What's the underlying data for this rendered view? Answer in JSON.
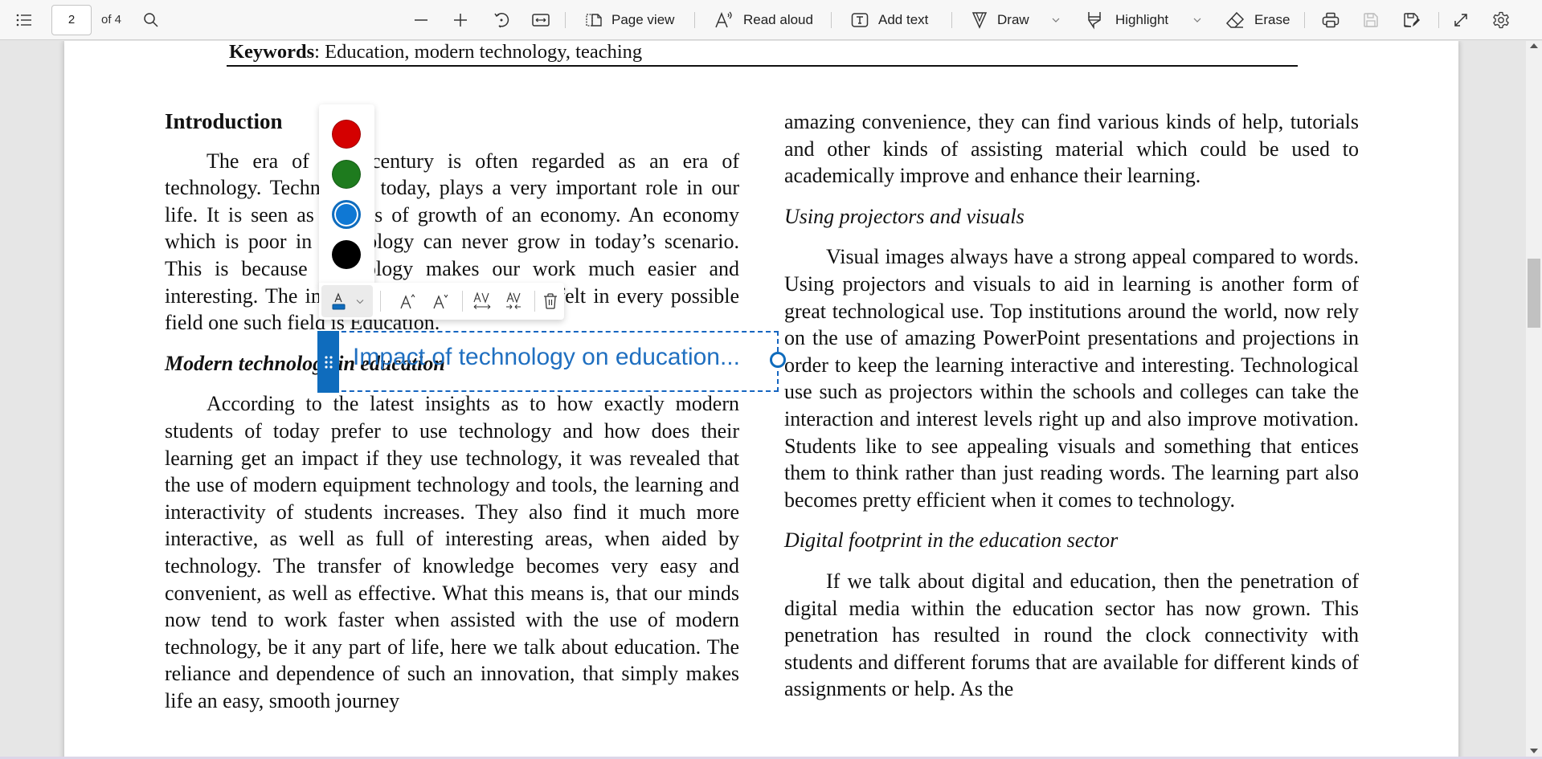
{
  "toolbar": {
    "contents_label": "Table of contents",
    "page_current": "2",
    "page_total_label": "of 4",
    "search_label": "Find",
    "zoom_out_label": "Zoom out",
    "zoom_in_label": "Zoom in",
    "rotate_label": "Rotate",
    "fit_label": "Fit to width",
    "page_view_label": "Page view",
    "read_aloud_label": "Read aloud",
    "add_text_label": "Add text",
    "draw_label": "Draw",
    "highlight_label": "Highlight",
    "erase_label": "Erase",
    "print_label": "Print",
    "save_label": "Save",
    "save_as_label": "Save as",
    "fullscreen_label": "Full screen",
    "settings_label": "Settings"
  },
  "document": {
    "keywords_label": "Keywords",
    "keywords_value": ": Education, modern technology, teaching",
    "left_column": {
      "intro_heading": "Introduction",
      "intro_para": "The era of 21st century is often regarded as an era of technology. Technology, today, plays a very important role in our life. It is seen as a basis of growth of an economy. An economy which is poor in technology can never grow in today’s scenario. This is because technology makes our work much easier and interesting. The impact of technology can be felt in every possible field one such field is Education.",
      "modern_heading": "Modern technology in education",
      "modern_para": "According to the latest insights as to how exactly modern students of today prefer to use technology and how does their learning get an impact if they use technology, it was revealed that the use of modern equipment technology and tools, the learning and interactivity of students increases. They also find it much more interactive, as well as full of interesting areas, when aided by technology. The transfer of knowledge becomes very easy and convenient, as well as effective. What this means is, that our minds now tend to work faster when assisted with the use of modern technology, be it any part of life, here we talk about education. The reliance and dependence of such an innovation, that simply makes life an easy, smooth journey"
    },
    "right_column": {
      "continued_para": "amazing convenience, they can find various kinds of help, tutorials and other kinds of assisting material which could be used to academically improve and enhance their learning.",
      "projectors_heading": "Using projectors and visuals",
      "projectors_para": "Visual images always have a strong appeal compared to words. Using projectors and visuals to aid in learning is another form of great technological use. Top institutions around the world, now rely on the use of amazing PowerPoint presentations and projections in order to keep the learning interactive and interesting. Technological use such as projectors within the schools and colleges can take the interaction and interest levels right up and also improve motivation. Students like to see appealing visuals and something that entices them to think rather than just reading words. The learning part also becomes pretty efficient when it comes to technology.",
      "digital_heading": "Digital footprint in the education sector",
      "digital_para": "If we talk about digital and education, then the penetration of digital media within the education sector has now grown. This penetration has resulted in round the clock connectivity with students and different forums that are available for different kinds of assignments or help. As the"
    }
  },
  "annotation": {
    "text_box_content": "Impact of technology on education...",
    "color_palette": [
      {
        "name": "red",
        "hex": "#d40000",
        "selected": false
      },
      {
        "name": "green",
        "hex": "#1e7b1e",
        "selected": false
      },
      {
        "name": "blue",
        "hex": "#0f78d4",
        "selected": true
      },
      {
        "name": "black",
        "hex": "#000000",
        "selected": false
      }
    ],
    "format_toolbar": {
      "text_color_label": "Text color",
      "increase_size_label": "Increase font size",
      "decrease_size_label": "Decrease font size",
      "increase_spacing_label": "Increase text spacing",
      "decrease_spacing_label": "Decrease text spacing",
      "delete_label": "Delete"
    },
    "accent_color": "#0f6cbd"
  }
}
